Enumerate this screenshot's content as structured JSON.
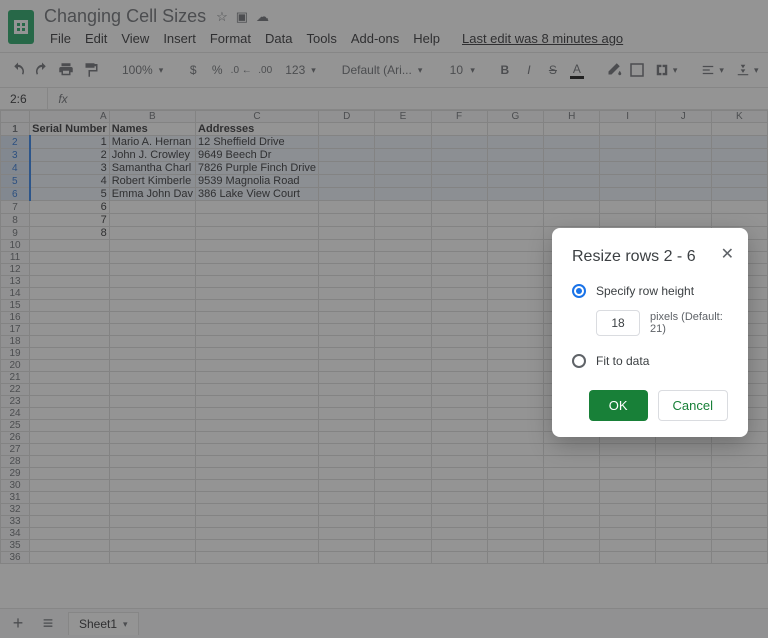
{
  "doc": {
    "title": "Changing Cell Sizes",
    "last_edit": "Last edit was 8 minutes ago"
  },
  "menus": [
    "File",
    "Edit",
    "View",
    "Insert",
    "Format",
    "Data",
    "Tools",
    "Add-ons",
    "Help"
  ],
  "toolbar": {
    "zoom": "100%",
    "currency": "$",
    "percent": "%",
    "dec_less": ".0",
    "dec_more": ".00",
    "num_format": "123",
    "font": "Default (Ari...",
    "font_size": "10"
  },
  "namebox": "2:6",
  "columns": [
    "A",
    "B",
    "C",
    "D",
    "E",
    "F",
    "G",
    "H",
    "I",
    "J",
    "K"
  ],
  "rows": [
    {
      "n": 1,
      "a": "Serial Number",
      "b": "Names",
      "c": "Addresses",
      "header": true
    },
    {
      "n": 2,
      "a": "1",
      "b": "Mario A. Hernan",
      "c": "12 Sheffield Drive",
      "sel": true
    },
    {
      "n": 3,
      "a": "2",
      "b": "John J. Crowley",
      "c": "9649 Beech Dr",
      "sel": true
    },
    {
      "n": 4,
      "a": "3",
      "b": "Samantha Charl",
      "c": "7826 Purple Finch Drive",
      "sel": true
    },
    {
      "n": 5,
      "a": "4",
      "b": "Robert Kimberle",
      "c": "9539 Magnolia Road",
      "sel": true
    },
    {
      "n": 6,
      "a": "5",
      "b": "Emma John Dav",
      "c": "386 Lake View Court",
      "sel": true
    },
    {
      "n": 7,
      "a": "6",
      "b": "",
      "c": ""
    },
    {
      "n": 8,
      "a": "7",
      "b": "",
      "c": ""
    },
    {
      "n": 9,
      "a": "8",
      "b": "",
      "c": ""
    },
    {
      "n": 10
    },
    {
      "n": 11
    },
    {
      "n": 12
    },
    {
      "n": 13
    },
    {
      "n": 14
    },
    {
      "n": 15
    },
    {
      "n": 16
    },
    {
      "n": 17
    },
    {
      "n": 18
    },
    {
      "n": 19
    },
    {
      "n": 20
    },
    {
      "n": 21
    },
    {
      "n": 22
    },
    {
      "n": 23
    },
    {
      "n": 24
    },
    {
      "n": 25
    },
    {
      "n": 26
    },
    {
      "n": 27
    },
    {
      "n": 28
    },
    {
      "n": 29
    },
    {
      "n": 30
    },
    {
      "n": 31
    },
    {
      "n": 32
    },
    {
      "n": 33
    },
    {
      "n": 34
    },
    {
      "n": 35
    },
    {
      "n": 36
    }
  ],
  "sheet_tab": "Sheet1",
  "dialog": {
    "title": "Resize rows 2 - 6",
    "opt1": "Specify row height",
    "height_value": "18",
    "height_hint": "pixels (Default: 21)",
    "opt2": "Fit to data",
    "ok": "OK",
    "cancel": "Cancel"
  }
}
